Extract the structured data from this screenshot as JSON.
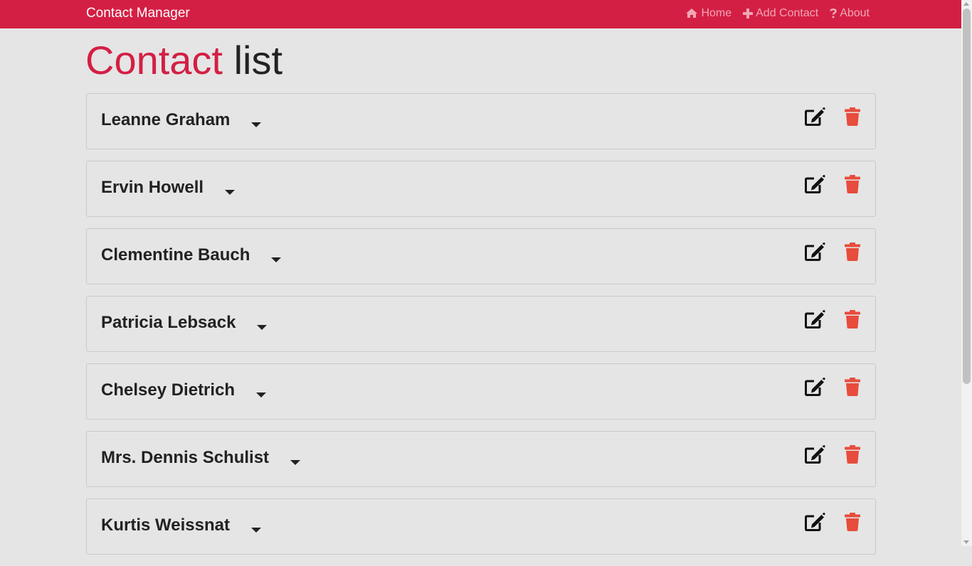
{
  "navbar": {
    "brand": "Contact Manager",
    "links": [
      {
        "label": "Home",
        "icon": "home-icon"
      },
      {
        "label": "Add Contact",
        "icon": "plus-icon"
      },
      {
        "label": "About",
        "icon": "question-icon"
      }
    ]
  },
  "page": {
    "title_accent": "Contact",
    "title_rest": "list"
  },
  "contacts": [
    {
      "name": "Leanne Graham"
    },
    {
      "name": "Ervin Howell"
    },
    {
      "name": "Clementine Bauch"
    },
    {
      "name": "Patricia Lebsack"
    },
    {
      "name": "Chelsey Dietrich"
    },
    {
      "name": "Mrs. Dennis Schulist"
    },
    {
      "name": "Kurtis Weissnat"
    }
  ],
  "colors": {
    "brand": "#d41f44",
    "delete": "#e74c3c",
    "background": "#e5e5e5"
  }
}
